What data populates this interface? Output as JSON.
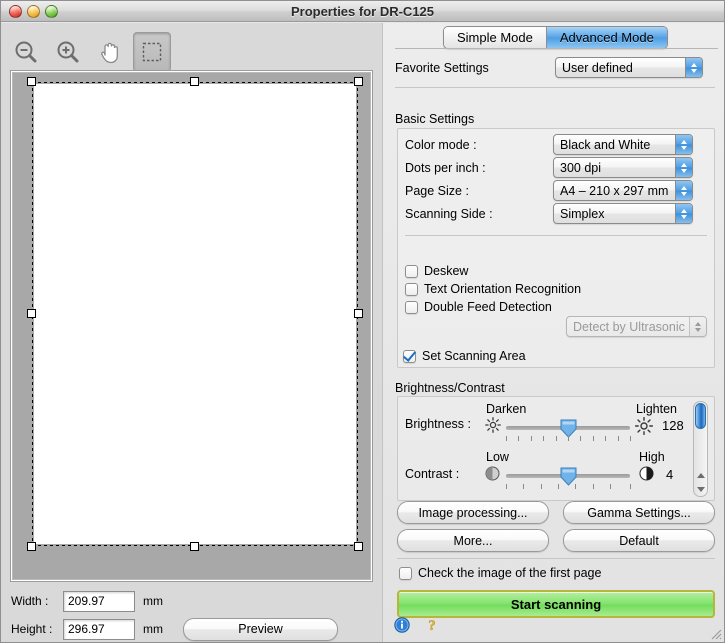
{
  "window": {
    "title": "Properties for DR-C125",
    "controls": [
      "close",
      "minimize",
      "zoom"
    ]
  },
  "preview_toolbar": {
    "tools": [
      {
        "name": "zoom-out-icon",
        "label": "Zoom Out"
      },
      {
        "name": "zoom-in-icon",
        "label": "Zoom In"
      },
      {
        "name": "hand-icon",
        "label": "Pan"
      },
      {
        "name": "selection-icon",
        "label": "Select Scanning Area",
        "active": true
      }
    ]
  },
  "preview": {
    "width_label": "Width :",
    "width_value": "209.97",
    "width_unit": "mm",
    "height_label": "Height :",
    "height_value": "296.97",
    "height_unit": "mm",
    "preview_button": "Preview"
  },
  "tabs": {
    "items": [
      {
        "label": "Simple Mode",
        "selected": false
      },
      {
        "label": "Advanced Mode",
        "selected": true
      }
    ]
  },
  "favorite": {
    "label": "Favorite Settings",
    "value": "User defined"
  },
  "basic_settings": {
    "title": "Basic Settings",
    "rows": [
      {
        "label": "Color mode :",
        "value": "Black and White"
      },
      {
        "label": "Dots per inch :",
        "value": "300 dpi"
      },
      {
        "label": "Page Size :",
        "value": "A4 – 210 x 297 mm"
      },
      {
        "label": "Scanning Side :",
        "value": "Simplex"
      }
    ],
    "checkboxes": [
      {
        "label": "Deskew",
        "checked": false
      },
      {
        "label": "Text Orientation Recognition",
        "checked": false
      },
      {
        "label": "Double Feed Detection",
        "checked": false
      }
    ],
    "double_feed_method": "Detect by Ultrasonic",
    "double_feed_method_disabled": true,
    "set_scanning_area": {
      "label": "Set Scanning Area",
      "checked": true
    }
  },
  "brightness_contrast": {
    "title": "Brightness/Contrast",
    "brightness": {
      "label": "Brightness :",
      "low_label": "Darken",
      "high_label": "Lighten",
      "value": "128",
      "position_pct": 50
    },
    "contrast": {
      "label": "Contrast :",
      "low_label": "Low",
      "high_label": "High",
      "value": "4",
      "position_pct": 50
    }
  },
  "action_buttons": {
    "image_processing": "Image processing...",
    "gamma_settings": "Gamma Settings...",
    "more": "More...",
    "default": "Default"
  },
  "check_first_page": {
    "label": "Check the image of the first page",
    "checked": false
  },
  "start_scanning": {
    "label": "Start scanning"
  },
  "status_icons": [
    {
      "name": "info-icon",
      "glyph": "i"
    },
    {
      "name": "help-icon",
      "glyph": "?"
    }
  ],
  "colors": {
    "accent_blue": "#4e9ee4",
    "start_green": "#87e473",
    "start_border": "#b6b63a",
    "window_bg": "#e2e2e2",
    "preview_bg": "#a8a8a8"
  }
}
